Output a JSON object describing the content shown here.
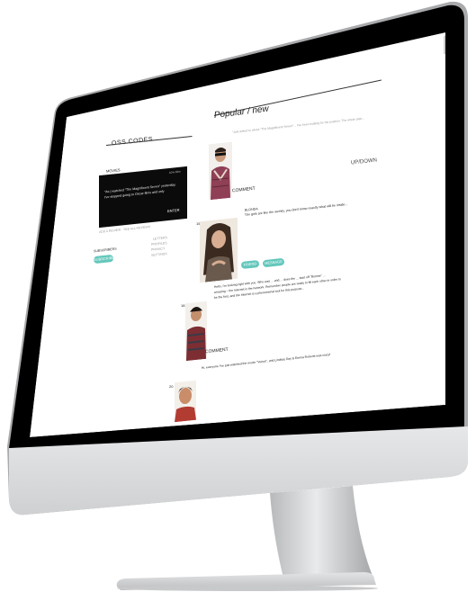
{
  "left_panel": {
    "title": "OSS.CODES",
    "section_label": "MOVIES",
    "box_header": "10% Film",
    "box_text_1": "\"As | watched \"The Magnificent Seven\" yesterday,",
    "box_text_2": "I've stopped going to Oscar films and only",
    "box_enter": "ENTER",
    "box_caption": "ADD A REVIEW  ·  SEE ALL REVIEWS",
    "col1_label": "SUBSCRIBERS",
    "col1_button": "SUBSCRIBE",
    "col2_label": "LETTERS",
    "col2_items": [
      "PROFILES",
      "PRIVACY",
      "SETTINGS"
    ]
  },
  "feed": {
    "title": "Popular / new",
    "top_note": "\"Just asked to about \"The Magnificent Seven\"... I've been waiting for his position. The whole plan...",
    "posts": [
      {
        "number": "10th",
        "text": "",
        "action": "COMMENT",
        "right_label": "UP/DOWN"
      },
      {
        "number": "15th",
        "author": "BLONDA",
        "text": "The girls are like the weekly, you don't know exactly what will be inside...",
        "buttons": [
          "FRIEND",
          "MESSAGE"
        ]
      },
      {
        "number": "18",
        "text_1": "Hello, I'm looking right with you. Who was ... and ... does the ... start off \"Bonnie\" ... ",
        "text_2": "amazing – the Internet is the network. Remember people are ready to fill each other in order to",
        "text_3": "be the first, and the Internet is a phenomenal tool for this purpose...",
        "action": "COMMENT"
      },
      {
        "number": "20",
        "text": "Hi, everyone I've just watched the movie \"Venus\", and Lindsay Day & Emma Roberts was crazy!"
      }
    ]
  },
  "colors": {
    "accent": "#63c7bb",
    "bezel": "#000000",
    "chin": "#d9dadb",
    "stand": "#c9cacc"
  }
}
